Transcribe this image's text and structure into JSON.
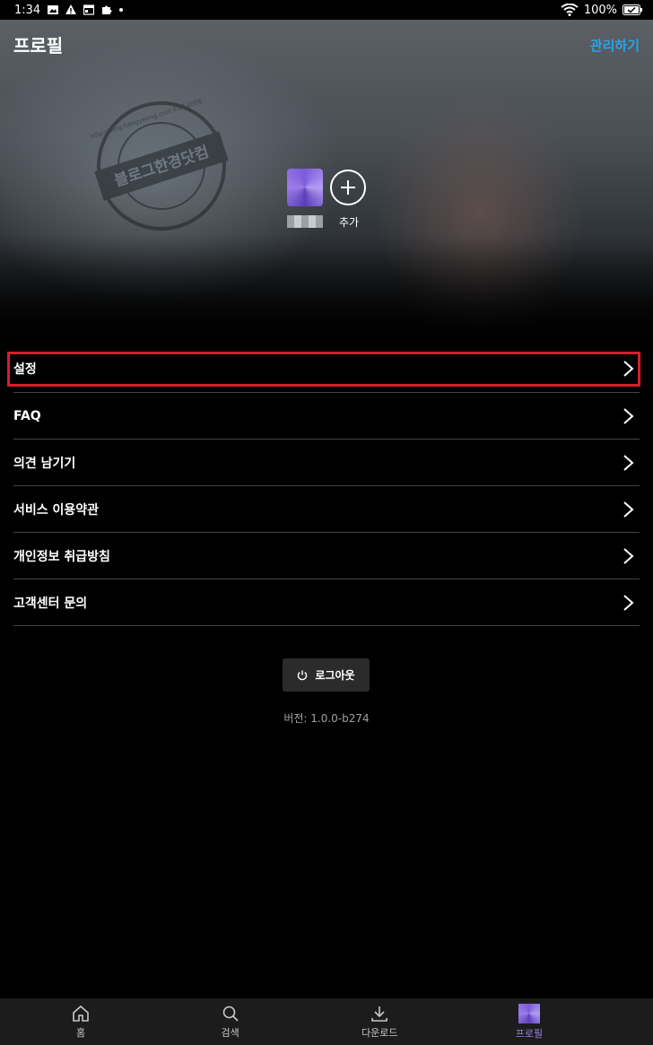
{
  "status_bar": {
    "time": "1:34",
    "battery": "100%"
  },
  "header": {
    "title": "프로필",
    "manage_label": "관리하기"
  },
  "watermark": {
    "center_text": "블로그한경닷컴",
    "ring_text": "http://blog.hangyeong.com EST 2006"
  },
  "profile": {
    "add_label": "추가"
  },
  "menu": {
    "items": [
      {
        "label": "설정"
      },
      {
        "label": "FAQ"
      },
      {
        "label": "의견 남기기"
      },
      {
        "label": "서비스 이용약관"
      },
      {
        "label": "개인정보 취급방침"
      },
      {
        "label": "고객센터 문의"
      }
    ]
  },
  "logout": {
    "label": "로그아웃"
  },
  "version_text": "버전: 1.0.0-b274",
  "bottom_nav": {
    "home": "홈",
    "search": "검색",
    "downloads": "다운로드",
    "profile": "프로필",
    "active": "profile"
  },
  "colors": {
    "accent": "#2aa3e6",
    "highlight": "#d81d2b",
    "active_tab": "#9b7de8"
  }
}
